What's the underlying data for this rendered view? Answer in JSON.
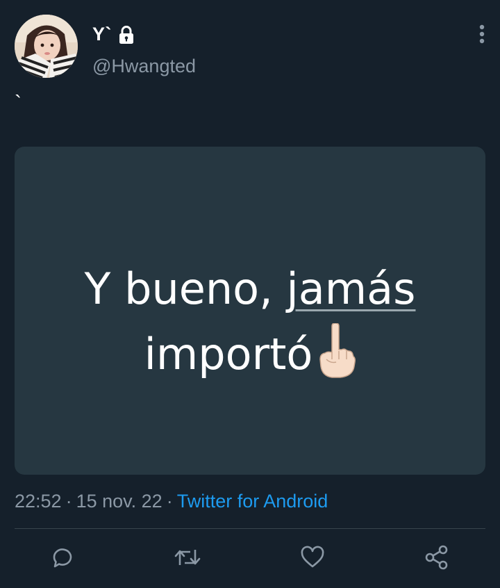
{
  "tweet": {
    "display_name": "Y`",
    "handle": "@Hwangted",
    "text": "`",
    "locked": true,
    "avatar_icon": "avatar-photo"
  },
  "media": {
    "line1_prefix": "Y bueno, ",
    "line1_underlined": "jamás",
    "line2_text": "importó",
    "emoji": "☝🏻"
  },
  "meta": {
    "time": "22:52",
    "separator": "·",
    "date": "15 nov. 22",
    "source": "Twitter for Android"
  },
  "actions": {
    "reply_icon": "reply-icon",
    "retweet_icon": "retweet-icon",
    "like_icon": "heart-icon",
    "share_icon": "share-icon"
  },
  "colors": {
    "background": "#15202b",
    "card": "#263741",
    "secondary_text": "#8b98a5",
    "link": "#1d9bf0",
    "divider": "#38444d"
  }
}
